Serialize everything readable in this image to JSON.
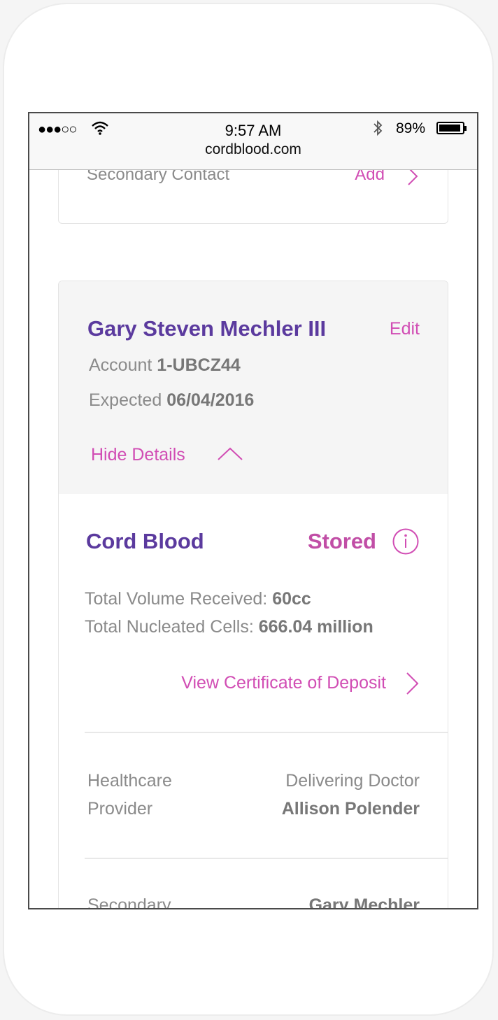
{
  "status_bar": {
    "signal": "●●●○○",
    "time": "9:57 AM",
    "battery": "89%",
    "url": "cordblood.com"
  },
  "top_card": {
    "label": "Secondary Contact",
    "action": "Add"
  },
  "account_card": {
    "name": "Gary Steven Mechler III",
    "edit": "Edit",
    "account_label": "Account",
    "account_value": "1-UBCZ44",
    "expected_label": "Expected",
    "expected_value": "06/04/2016",
    "toggle": "Hide Details"
  },
  "cord_blood": {
    "title": "Cord Blood",
    "status": "Stored",
    "volume_label": "Total Volume Received:",
    "volume_value": "60cc",
    "cells_label": "Total Nucleated Cells:",
    "cells_value": "666.04 million",
    "certificate_link": "View Certificate of Deposit"
  },
  "provider": {
    "label_line1": "Healthcare",
    "label_line2": "Provider",
    "role": "Delivering Doctor",
    "name": "Allison Polender"
  },
  "secondary": {
    "label": "Secondary",
    "name": "Gary Mechler"
  },
  "colors": {
    "accent_pink": "#d14db4",
    "title_purple": "#5b3a9e"
  }
}
